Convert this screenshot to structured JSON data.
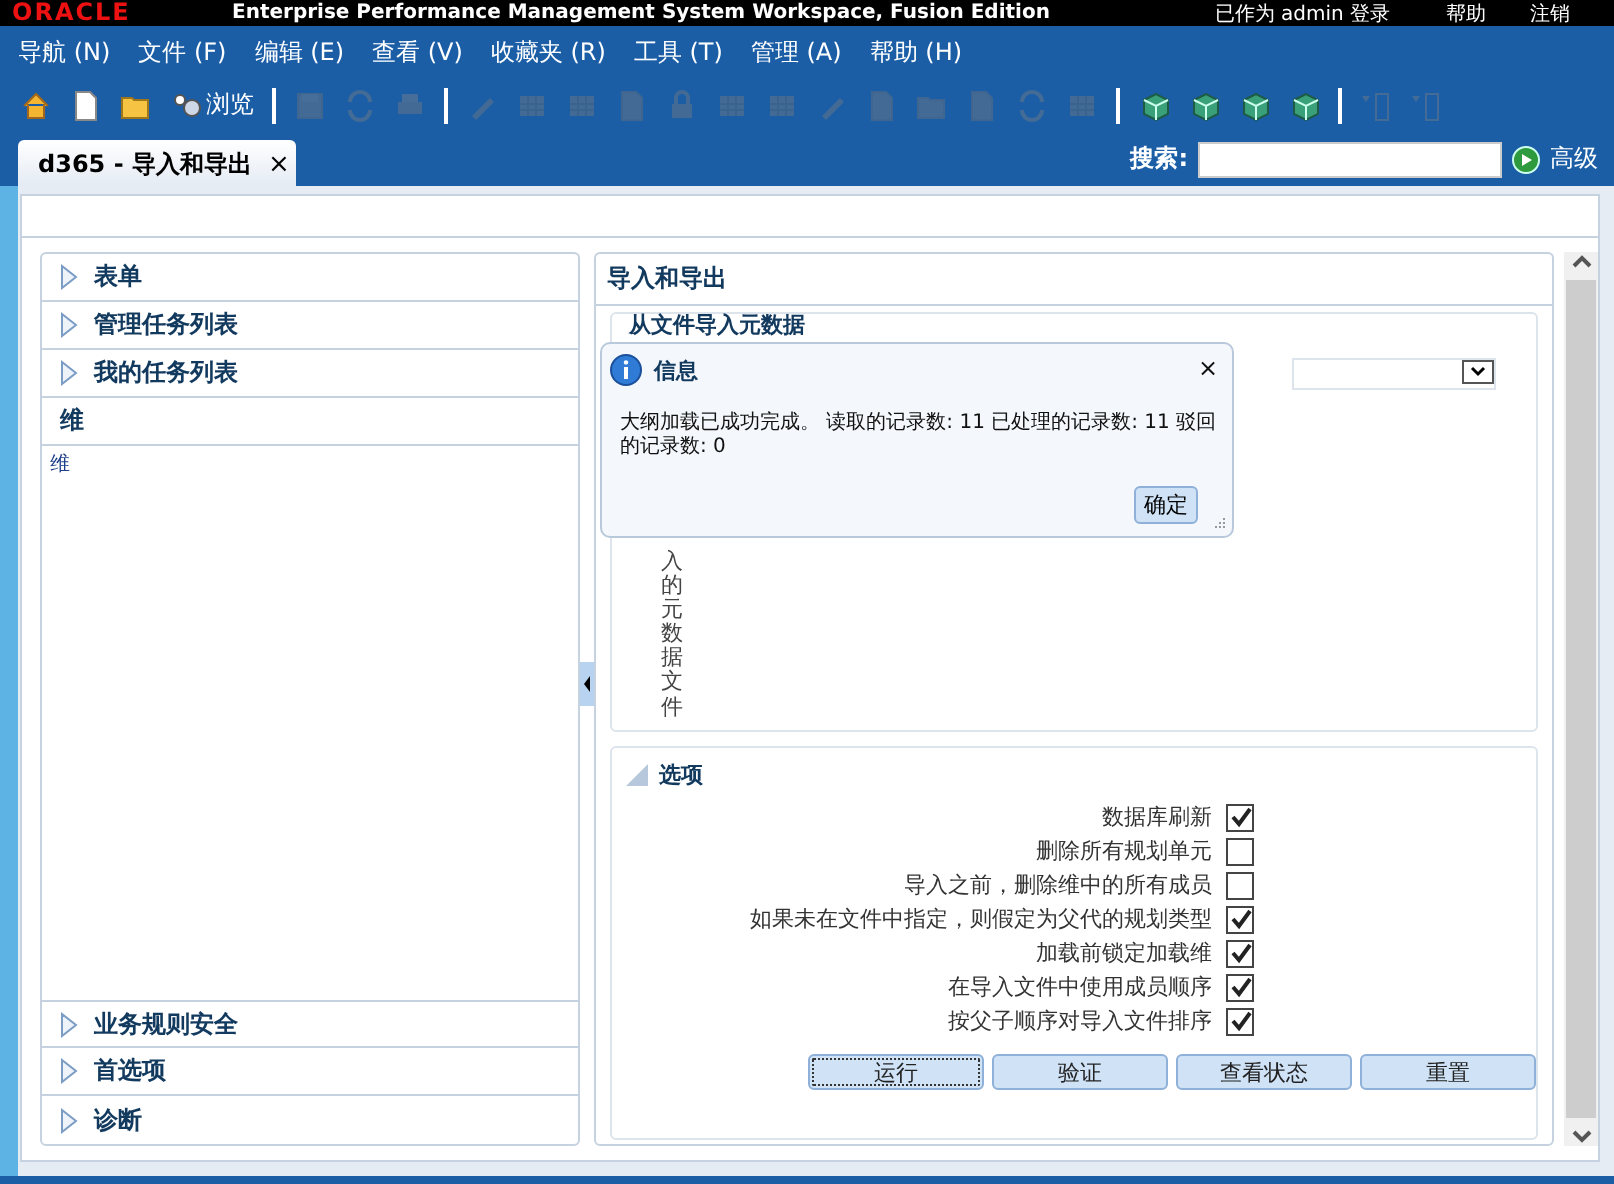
{
  "header": {
    "logo": "ORACLE",
    "title": "Enterprise Performance Management System Workspace, Fusion Edition",
    "user": "已作为 admin 登录",
    "links": [
      "帮助",
      "注销"
    ]
  },
  "menu": [
    "导航 (N)",
    "文件 (F)",
    "编辑 (E)",
    "查看 (V)",
    "收藏夹 (R)",
    "工具 (T)",
    "管理 (A)",
    "帮助 (H)"
  ],
  "toolbar": [
    {
      "kind": "house",
      "disabled": false
    },
    {
      "kind": "page",
      "disabled": false
    },
    {
      "kind": "folder",
      "disabled": false
    },
    {
      "kind": "browse",
      "label": "浏览",
      "disabled": false
    },
    {
      "kind": "sep"
    },
    {
      "kind": "disk",
      "disabled": true
    },
    {
      "kind": "arrows",
      "disabled": true
    },
    {
      "kind": "printer",
      "disabled": true
    },
    {
      "kind": "sep"
    },
    {
      "kind": "pencil",
      "disabled": true
    },
    {
      "kind": "grid",
      "disabled": true
    },
    {
      "kind": "grid",
      "disabled": true
    },
    {
      "kind": "page",
      "disabled": true
    },
    {
      "kind": "lock",
      "disabled": true
    },
    {
      "kind": "grid",
      "disabled": true
    },
    {
      "kind": "grid",
      "disabled": true
    },
    {
      "kind": "pencil",
      "disabled": true
    },
    {
      "kind": "page",
      "disabled": true
    },
    {
      "kind": "folder",
      "disabled": true
    },
    {
      "kind": "page",
      "disabled": true
    },
    {
      "kind": "arrows",
      "disabled": true
    },
    {
      "kind": "grid",
      "disabled": true
    },
    {
      "kind": "sep"
    },
    {
      "kind": "cube",
      "disabled": false
    },
    {
      "kind": "cube",
      "disabled": false
    },
    {
      "kind": "cube",
      "disabled": false
    },
    {
      "kind": "cube",
      "disabled": false
    },
    {
      "kind": "sep"
    },
    {
      "kind": "list",
      "disabled": true
    },
    {
      "kind": "list",
      "disabled": true
    }
  ],
  "tab": {
    "label": "d365 - 导入和导出",
    "close": "×",
    "selected": true
  },
  "search": {
    "label": "搜索:",
    "advanced": "高级"
  },
  "nav_top": [
    {
      "label": "表单",
      "expanded": false
    },
    {
      "label": "管理任务列表",
      "expanded": false
    },
    {
      "label": "我的任务列表",
      "expanded": false
    },
    {
      "label": "维",
      "expanded": true,
      "content": "维"
    }
  ],
  "nav_bottom": [
    {
      "label": "业务规则安全",
      "expanded": false
    },
    {
      "label": "首选项",
      "expanded": false
    },
    {
      "label": "诊断",
      "expanded": false
    }
  ],
  "panel": {
    "title": "导入和导出",
    "section_title": "从文件导入元数据",
    "file_label": "入的元数据文件"
  },
  "options": {
    "title": "选项",
    "items": [
      {
        "label": "数据库刷新",
        "checked": true
      },
      {
        "label": "删除所有规划单元",
        "checked": false
      },
      {
        "label": "导入之前，删除维中的所有成员",
        "checked": false
      },
      {
        "label": "如果未在文件中指定，则假定为父代的规划类型",
        "checked": true
      },
      {
        "label": "加载前锁定加载维",
        "checked": true
      },
      {
        "label": "在导入文件中使用成员顺序",
        "checked": true
      },
      {
        "label": "按父子顺序对导入文件排序",
        "checked": true
      }
    ]
  },
  "buttons": [
    {
      "label": "运行",
      "focused": true
    },
    {
      "label": "验证",
      "focused": false
    },
    {
      "label": "查看状态",
      "focused": false
    },
    {
      "label": "重置",
      "focused": false
    }
  ],
  "dialog": {
    "title": "信息",
    "close": "×",
    "message": "大纲加载已成功完成。 读取的记录数: 11 已处理的记录数: 11 驳回的记录数: 0",
    "ok": "确定"
  }
}
